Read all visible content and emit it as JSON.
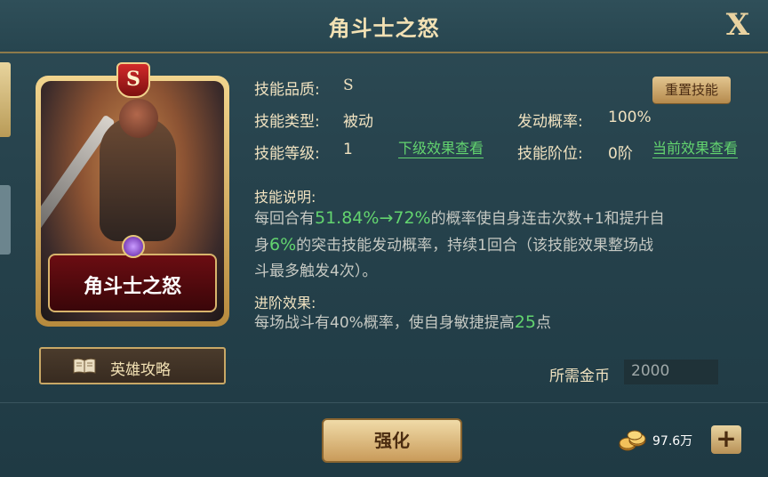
{
  "header": {
    "title": "角斗士之怒",
    "close_label": "X"
  },
  "card": {
    "grade": "S",
    "name": "角斗士之怒"
  },
  "guide_button": {
    "label": "英雄攻略"
  },
  "info": {
    "quality_label": "技能品质:",
    "quality_value": "S",
    "type_label": "技能类型:",
    "type_value": "被动",
    "prob_label": "发动概率:",
    "prob_value": "100%",
    "level_label": "技能等级:",
    "level_value": "1",
    "next_link": "下级效果查看",
    "rank_label": "技能阶位:",
    "rank_value": "0阶",
    "current_link": "当前效果查看",
    "reset_label": "重置技能"
  },
  "description": {
    "title": "技能说明:",
    "line1_a": "每回合有",
    "line1_hl": "51.84%→72%",
    "line1_b": "的概率使自身连击次数+1和提升自",
    "line2_a": "身",
    "line2_hl": "6%",
    "line2_b": "的突击技能发动概率，持续1回合（该技能效果整场战",
    "line3": "斗最多触发4次）。"
  },
  "advance": {
    "title": "进阶效果:",
    "text_a": "每场战斗有40%概率，使自身敏捷提高",
    "text_hl": "25",
    "text_b": "点"
  },
  "cost": {
    "label": "所需金币",
    "value": "2000"
  },
  "enhance": {
    "label": "强化"
  },
  "currency": {
    "value": "97.6万",
    "plus": "+"
  },
  "colors": {
    "highlight": "#63d46f",
    "gold": "#f0e2c0",
    "card_red": "#6b0d12"
  }
}
